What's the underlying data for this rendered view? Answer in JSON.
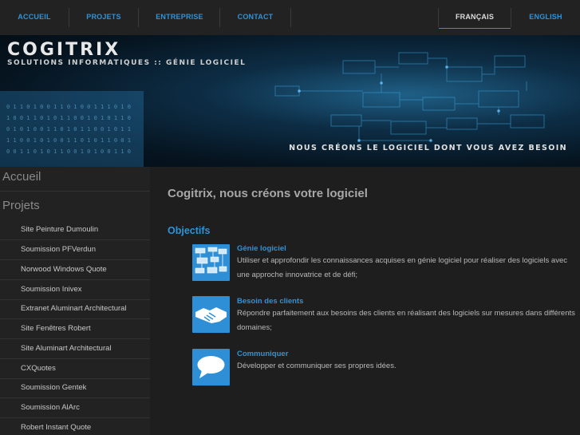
{
  "nav": {
    "items": [
      "ACCUEIL",
      "PROJETS",
      "ENTREPRISE",
      "CONTACT"
    ],
    "languages": [
      "FRANÇAIS",
      "ENGLISH"
    ],
    "active_language": "FRANÇAIS"
  },
  "banner": {
    "brand": "COGITRIX",
    "subtitle": "SOLUTIONS INFORMATIQUES :: GÉNIE LOGICIEL",
    "tagline": "NOUS CRÉONS LE LOGICIEL DONT VOUS AVEZ BESOIN"
  },
  "sidebar": {
    "home": "Accueil",
    "projects_heading": "Projets",
    "projects": [
      "Site Peinture Dumoulin",
      "Soumission PFVerdun",
      "Norwood Windows Quote",
      "Soumission Inivex",
      "Extranet Aluminart Architectural",
      "Site Fenêtres Robert",
      "Site Aluminart Architectural",
      "CXQuotes",
      "Soumission Gentek",
      "Soumission AlArc",
      "Robert Instant Quote"
    ]
  },
  "main": {
    "title": "Cogitrix, nous créons votre logiciel",
    "section": "Objectifs",
    "objectives": [
      {
        "icon": "diagram-icon",
        "title": "Génie logiciel",
        "line1": "Utiliser et approfondir les connaissances acquises en génie logiciel pour réaliser des logiciels avec",
        "line2": "une approche innovatrice et de défi;"
      },
      {
        "icon": "handshake-icon",
        "title": "Besoin des clients",
        "line1": "Répondre parfaitement aux besoins des clients en réalisant des logiciels sur mesures dans différents",
        "line2": "domaines;"
      },
      {
        "icon": "speech-bubble-icon",
        "title": "Communiquer",
        "line1": "Développer et communiquer ses propres idées.",
        "line2": ""
      }
    ]
  },
  "colors": {
    "accent": "#2f93d9",
    "background": "#1e1e1e",
    "banner": "#0d2d45"
  }
}
